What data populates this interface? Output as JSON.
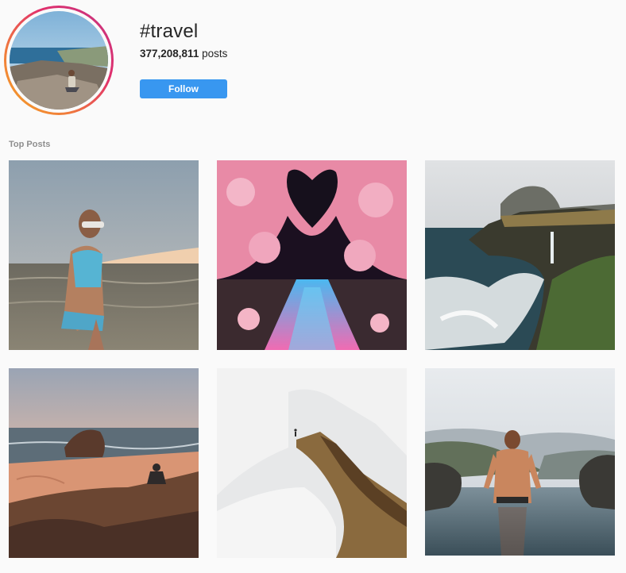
{
  "hashtag": {
    "title": "#travel",
    "post_count": "377,208,811",
    "post_count_suffix": " posts",
    "follow_label": "Follow"
  },
  "top_posts": {
    "label": "Top Posts",
    "posts": [
      {
        "subject": "woman in swimsuit by the sea with sand dune"
      },
      {
        "subject": "cherry blossom tunnel over illuminated canal at night"
      },
      {
        "subject": "cliffs with waterfall and crashing waves"
      },
      {
        "subject": "man sitting on rocks at sunset beach"
      },
      {
        "subject": "hiker on foggy mountain ridge"
      },
      {
        "subject": "man standing in infinity pool in mountains"
      }
    ]
  },
  "colors": {
    "accent": "#3897f0",
    "background": "#fafafa",
    "text": "#262626",
    "muted": "#8e8e8e"
  }
}
